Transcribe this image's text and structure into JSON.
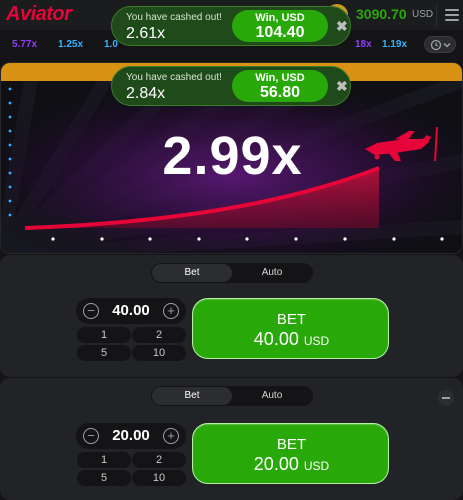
{
  "header": {
    "logo": "Aviator",
    "balance": "3090.70",
    "currency": "USD"
  },
  "history": {
    "items": [
      {
        "value": "5.77x",
        "color": "#913ef8"
      },
      {
        "value": "1.25x",
        "color": "#34b4ff"
      },
      {
        "value": "1.0",
        "color": "#34b4ff"
      },
      {
        "value": "18x",
        "color": "#913ef8"
      },
      {
        "value": "1.19x",
        "color": "#34b4ff"
      }
    ]
  },
  "game": {
    "multiplier": "2.99x",
    "accent": "#e50539"
  },
  "toasts": [
    {
      "label": "You have cashed out!",
      "multiplier": "2.61x",
      "win_label": "Win, USD",
      "win_value": "104.40"
    },
    {
      "label": "You have cashed out!",
      "multiplier": "2.84x",
      "win_label": "Win, USD",
      "win_value": "56.80"
    }
  ],
  "panels": [
    {
      "tabs": [
        "Bet",
        "Auto"
      ],
      "amount": "40.00",
      "quick": [
        "1",
        "2",
        "5",
        "10"
      ],
      "bet_label": "BET",
      "bet_amount": "40.00",
      "bet_currency": "USD"
    },
    {
      "tabs": [
        "Bet",
        "Auto"
      ],
      "amount": "20.00",
      "quick": [
        "1",
        "2",
        "5",
        "10"
      ],
      "bet_label": "BET",
      "bet_amount": "20.00",
      "bet_currency": "USD"
    }
  ],
  "icons": {
    "minus": "−",
    "plus": "+",
    "close": "✖"
  }
}
